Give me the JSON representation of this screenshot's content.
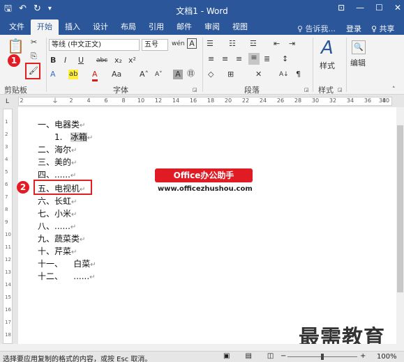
{
  "window": {
    "title": "文档1 - Word",
    "qat": {
      "save": "🖫",
      "undo": "↶",
      "redo": "↻",
      "more": "▾"
    },
    "controls": {
      "ribbon_opts": "⊡",
      "minimize": "—",
      "maximize": "☐",
      "close": "✕"
    }
  },
  "tabs": [
    "文件",
    "开始",
    "插入",
    "设计",
    "布局",
    "引用",
    "邮件",
    "审阅",
    "视图"
  ],
  "active_tab": "开始",
  "tell_me": "♀ 告诉我...",
  "login": "登录",
  "share": "♀ 共享",
  "ribbon": {
    "clipboard": {
      "label": "剪贴板",
      "paste_icon": "📋",
      "cut": "✂",
      "copy": "⎘",
      "format_painter": "🖌",
      "badge": "1"
    },
    "font": {
      "label": "字体",
      "font_name": "等线 (中文正文)",
      "font_size": "五号",
      "wen": "wén",
      "a_box": "A",
      "bold": "B",
      "italic": "I",
      "underline": "U",
      "strike": "abc",
      "sub": "x₂",
      "sup": "x²",
      "effects": "A",
      "highlight": "ab",
      "color": "A",
      "case": "Aa",
      "grow": "A˄",
      "shrink": "A˅",
      "char_shade": "A",
      "enclose": "㊐"
    },
    "paragraph": {
      "label": "段落",
      "bullets": "☰",
      "numbering": "☷",
      "multilevel": "☲",
      "dec_indent": "⇤",
      "inc_indent": "⇥",
      "align_left": "≡",
      "center": "≡",
      "align_right": "≡",
      "justify": "≡",
      "distribute": "≣",
      "spacing": "↕",
      "shading": "◇",
      "borders": "⊞",
      "chinese_layout": "✕",
      "sort": "A↓",
      "show_marks": "¶"
    },
    "styles": {
      "label": "样式",
      "icon": "A",
      "text": "样式"
    },
    "editing": {
      "icon": "🔍",
      "text": "编辑"
    }
  },
  "ruler_ticks": [
    "2",
    "2",
    "4",
    "6",
    "8",
    "10",
    "12",
    "14",
    "16",
    "18",
    "20",
    "22",
    "24",
    "26",
    "28",
    "30",
    "32",
    "34",
    "36",
    "38",
    "40"
  ],
  "vruler_ticks": [
    "1",
    "2",
    "3",
    "4",
    "5",
    "6",
    "7",
    "8",
    "9",
    "10",
    "11",
    "12",
    "13",
    "14",
    "15",
    "16",
    "17",
    "18"
  ],
  "document": {
    "lines": [
      {
        "text": "一、电器类",
        "mark": "↵"
      },
      {
        "num": "1.",
        "text": "冰箱",
        "mark": "↵",
        "highlight": true
      },
      {
        "text": "二、海尔",
        "mark": "↵"
      },
      {
        "text": "三、美的",
        "mark": "↵"
      },
      {
        "text": "四、......",
        "mark": "↵"
      },
      {
        "text": "五、电视机",
        "mark": "↵",
        "boxed": true
      },
      {
        "text": "六、长虹",
        "mark": "↵"
      },
      {
        "text": "七、小米",
        "mark": "↵"
      },
      {
        "text": "八、......",
        "mark": "↵"
      },
      {
        "text": "九、蔬菜类",
        "mark": "↵"
      },
      {
        "text": "十、芹菜",
        "mark": "↵"
      },
      {
        "text": "十一、    白菜",
        "mark": "↵"
      },
      {
        "text": "十二、    ......",
        "mark": "↵"
      }
    ],
    "badge2": "2"
  },
  "overlay": {
    "banner": "Office办公助手",
    "url": "www.officezhushou.com",
    "watermark": "最需教育"
  },
  "status": {
    "message": "选择要应用复制的格式的内容，或按 Esc 取消。",
    "view_read": "▣",
    "view_print": "▤",
    "view_web": "◫",
    "zoom_minus": "−",
    "zoom_plus": "+",
    "zoom": "100%"
  }
}
